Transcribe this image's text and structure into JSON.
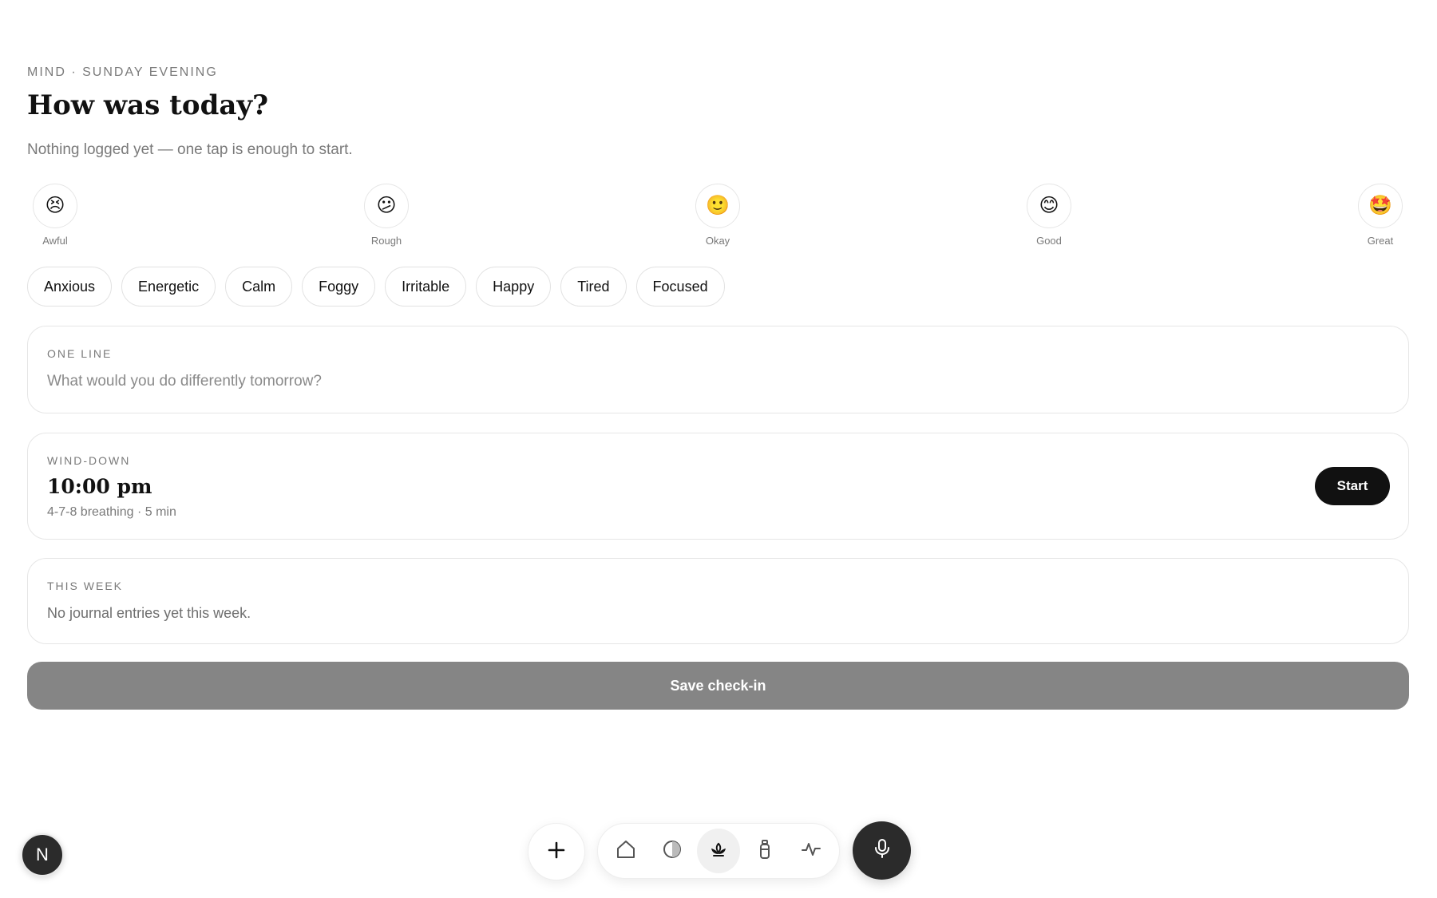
{
  "header": {
    "eyebrow": "MIND · SUNDAY EVENING",
    "title": "How was today?",
    "subtitle": "Nothing logged yet — one tap is enough to start."
  },
  "moods": [
    {
      "emoji": "😣",
      "label": "Awful"
    },
    {
      "emoji": "😕",
      "label": "Rough"
    },
    {
      "emoji": "🙂",
      "label": "Okay"
    },
    {
      "emoji": "😊",
      "label": "Good"
    },
    {
      "emoji": "🤩",
      "label": "Great"
    }
  ],
  "feelings": [
    "Anxious",
    "Energetic",
    "Calm",
    "Foggy",
    "Irritable",
    "Happy",
    "Tired",
    "Focused"
  ],
  "one_line": {
    "label": "ONE LINE",
    "placeholder": "What would you do differently tomorrow?"
  },
  "wind_down": {
    "label": "WIND-DOWN",
    "time": "10:00 pm",
    "detail": "4-7-8 breathing · 5 min",
    "start_label": "Start"
  },
  "this_week": {
    "label": "THIS WEEK",
    "text": "No journal entries yet this week."
  },
  "save_label": "Save check-in",
  "avatar_letter": "N",
  "nav": {
    "items": [
      {
        "icon": "home-icon"
      },
      {
        "icon": "half-circle-icon"
      },
      {
        "icon": "lotus-icon",
        "active": true
      },
      {
        "icon": "bottle-icon"
      },
      {
        "icon": "activity-icon"
      }
    ]
  },
  "colors": {
    "accent": "#111111",
    "muted": "#7a7a7a",
    "save_button": "#858585",
    "mic_button": "#2b2b2b"
  }
}
